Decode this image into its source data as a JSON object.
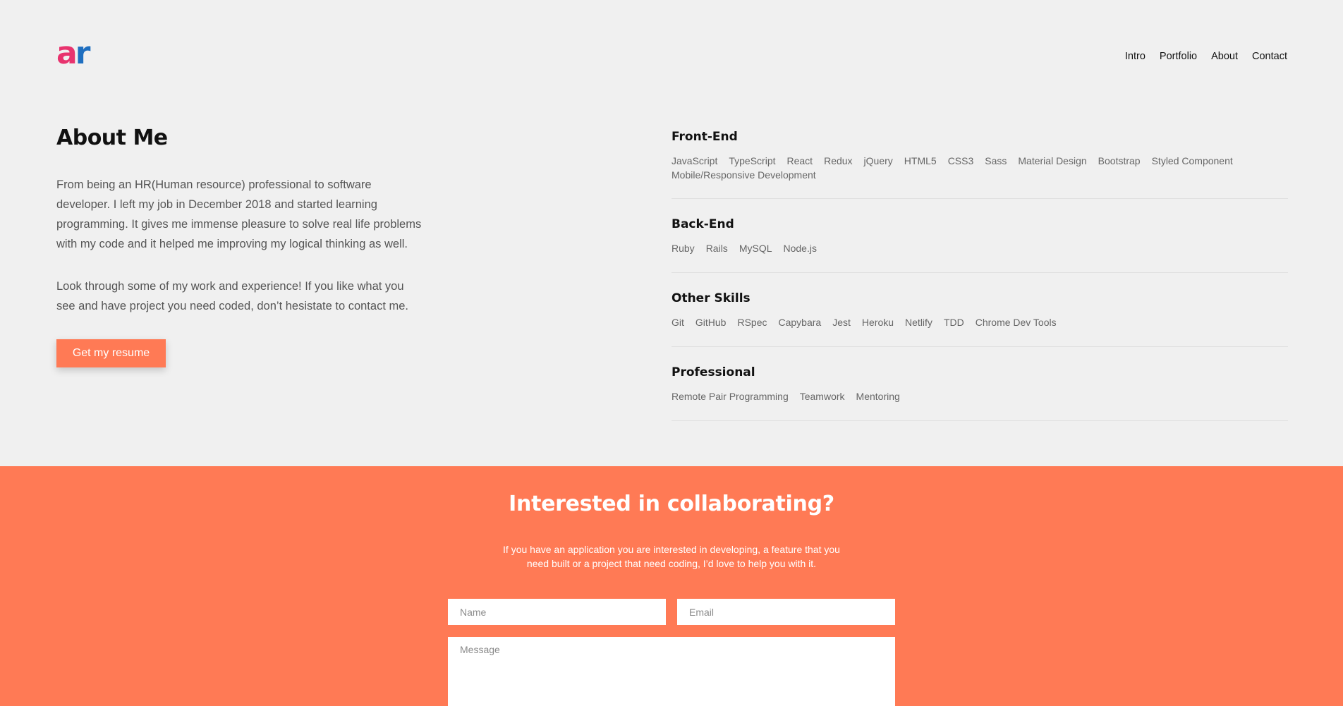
{
  "header": {
    "logo": {
      "a": "a",
      "r": "r"
    },
    "nav": [
      "Intro",
      "Portfolio",
      "About",
      "Contact"
    ]
  },
  "about": {
    "title": "About Me",
    "paragraph1": "From being an HR(Human resource) professional to software developer. I left my job in December 2018 and started learning programming. It gives me immense pleasure to solve real life problems with my code and it helped me improving my logical thinking as well.",
    "paragraph2": "Look through some of my work and experience! If you like what you see and have project you need coded, don’t hesistate to contact me.",
    "resume_button": "Get my resume"
  },
  "skills": [
    {
      "title": "Front-End",
      "items": [
        "JavaScript",
        "TypeScript",
        "React",
        "Redux",
        "jQuery",
        "HTML5",
        "CSS3",
        "Sass",
        "Material Design",
        "Bootstrap",
        "Styled Component",
        "Mobile/Responsive Development"
      ]
    },
    {
      "title": "Back-End",
      "items": [
        "Ruby",
        "Rails",
        "MySQL",
        "Node.js"
      ]
    },
    {
      "title": "Other Skills",
      "items": [
        "Git",
        "GitHub",
        "RSpec",
        "Capybara",
        "Jest",
        "Heroku",
        "Netlify",
        "TDD",
        "Chrome Dev Tools"
      ]
    },
    {
      "title": "Professional",
      "items": [
        "Remote Pair Programming",
        "Teamwork",
        "Mentoring"
      ]
    }
  ],
  "contact": {
    "title": "Interested in collaborating?",
    "description": "If you have an application you are interested in developing, a feature that you need built or a project that need coding, I’d love to help you with it.",
    "name_placeholder": "Name",
    "email_placeholder": "Email",
    "message_placeholder": "Message"
  },
  "colors": {
    "accent": "#ff7a55",
    "background": "#f0f0f0",
    "logo_a": "#e8336e",
    "logo_r": "#1f6fc0"
  }
}
